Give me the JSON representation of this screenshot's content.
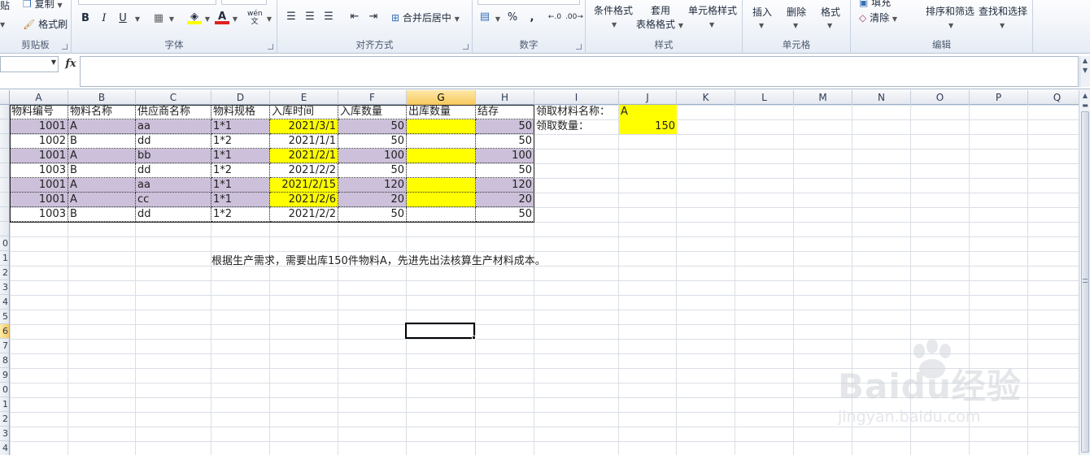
{
  "ribbon": {
    "clipboard": {
      "paste": "贴",
      "copy": "复制",
      "format_painter": "格式刷",
      "label": "剪贴板"
    },
    "font": {
      "bold": "B",
      "italic": "I",
      "underline": "U",
      "font_color": "A",
      "phonetic": "wén",
      "label": "字体"
    },
    "alignment": {
      "merge_center": "合并后居中",
      "label": "对齐方式"
    },
    "number": {
      "percent": "%",
      "comma": ",",
      "label": "数字"
    },
    "styles": {
      "conditional": "条件格式",
      "table_format_1": "套用",
      "table_format_2": "表格格式",
      "cell_styles": "单元格样式",
      "label": "样式"
    },
    "cells": {
      "insert": "插入",
      "delete": "删除",
      "format": "格式",
      "label": "单元格"
    },
    "editing": {
      "fill": "填充",
      "clear": "清除",
      "sort_filter": "排序和筛选",
      "find_select": "查找和选择",
      "label": "编辑"
    }
  },
  "formula_bar": {
    "fx": "fx",
    "value": ""
  },
  "columns": [
    "A",
    "B",
    "C",
    "D",
    "E",
    "F",
    "G",
    "H",
    "I",
    "J",
    "K",
    "L",
    "M",
    "N",
    "O",
    "P",
    "Q"
  ],
  "selected_column": "G",
  "row_headers": [
    "",
    "",
    "",
    "",
    "",
    "",
    "",
    "",
    "",
    "0",
    "1",
    "2",
    "3",
    "4",
    "5",
    "6",
    "7",
    "8",
    "9",
    "0",
    "1",
    "2",
    "3",
    "4"
  ],
  "selected_row_index": 15,
  "headers": [
    "物料编号",
    "物料名称",
    "供应商名称",
    "物料规格",
    "入库时间",
    "入库数量",
    "出库数量",
    "结存"
  ],
  "rows": [
    {
      "code": "1001",
      "name": "A",
      "supplier": "aa",
      "spec": "1*1",
      "date": "2021/3/1",
      "in_qty": "50",
      "out_qty": "",
      "balance": "50",
      "highlight": true
    },
    {
      "code": "1002",
      "name": "B",
      "supplier": "dd",
      "spec": "1*2",
      "date": "2021/1/1",
      "in_qty": "50",
      "out_qty": "",
      "balance": "50",
      "highlight": false
    },
    {
      "code": "1001",
      "name": "A",
      "supplier": "bb",
      "spec": "1*1",
      "date": "2021/2/1",
      "in_qty": "100",
      "out_qty": "",
      "balance": "100",
      "highlight": true
    },
    {
      "code": "1003",
      "name": "B",
      "supplier": "dd",
      "spec": "1*2",
      "date": "2021/2/2",
      "in_qty": "50",
      "out_qty": "",
      "balance": "50",
      "highlight": false
    },
    {
      "code": "1001",
      "name": "A",
      "supplier": "aa",
      "spec": "1*1",
      "date": "2021/2/15",
      "in_qty": "120",
      "out_qty": "",
      "balance": "120",
      "highlight": true
    },
    {
      "code": "1001",
      "name": "A",
      "supplier": "cc",
      "spec": "1*1",
      "date": "2021/2/6",
      "in_qty": "20",
      "out_qty": "",
      "balance": "20",
      "highlight": true
    },
    {
      "code": "1003",
      "name": "B",
      "supplier": "dd",
      "spec": "1*2",
      "date": "2021/2/2",
      "in_qty": "50",
      "out_qty": "",
      "balance": "50",
      "highlight": false
    }
  ],
  "side_info": {
    "material_label": "领取材料名称：",
    "material_value": "A",
    "qty_label": "领取数量：",
    "qty_value": "150"
  },
  "note": "根据生产需求，需要出库150件物料A，先进先出法核算生产材料成本。",
  "watermark": {
    "brand": "Baidu经验",
    "url": "jingyan.baidu.com"
  },
  "colors": {
    "highlight_row": "#ccc0da",
    "yellow_cell": "#ffff00",
    "selected_header": "#f7c75c"
  }
}
